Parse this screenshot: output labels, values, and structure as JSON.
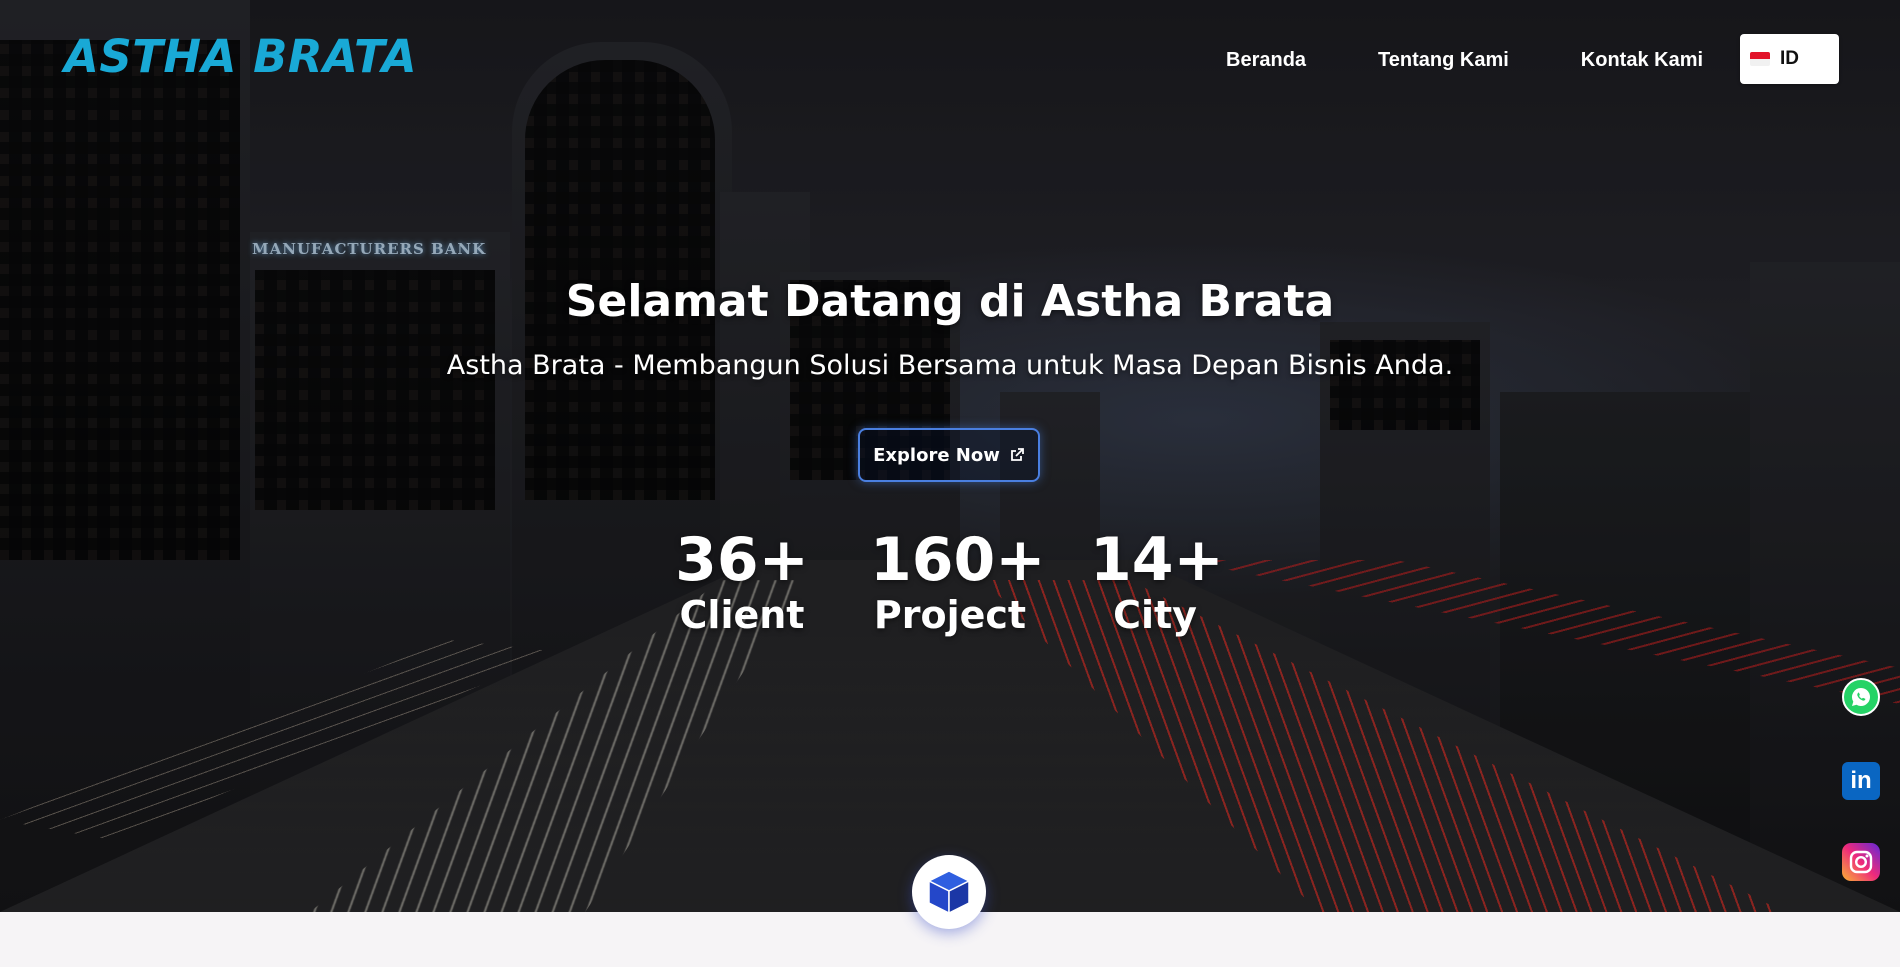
{
  "brand": {
    "logo_text": "ASTHA BRATA",
    "color": "#19a9d6"
  },
  "nav": {
    "items": [
      {
        "label": "Beranda"
      },
      {
        "label": "Tentang Kami"
      },
      {
        "label": "Kontak Kami"
      }
    ],
    "language": {
      "code": "ID",
      "flag_icon": "indonesia-flag-icon"
    }
  },
  "hero": {
    "title": "Selamat Datang di Astha Brata",
    "subtitle": "Astha Brata - Membangun Solusi Bersama untuk Masa Depan Bisnis Anda.",
    "cta": {
      "label": "Explore Now",
      "icon": "external-link-icon",
      "border_color": "#4a7fe0"
    },
    "stats": [
      {
        "value": "36+",
        "label": "Client"
      },
      {
        "value": "160+",
        "label": "Project"
      },
      {
        "value": "14+",
        "label": "City"
      }
    ],
    "background_sign": "MANUFACTURERS BANK"
  },
  "social": [
    {
      "name": "whatsapp",
      "icon": "whatsapp-icon",
      "color": "#25d366"
    },
    {
      "name": "linkedin",
      "icon": "linkedin-icon",
      "text": "in",
      "color": "#0a66c2"
    },
    {
      "name": "instagram",
      "icon": "instagram-icon"
    }
  ],
  "bottom_badge": {
    "icon": "cube-icon",
    "color": "#2447c9"
  }
}
